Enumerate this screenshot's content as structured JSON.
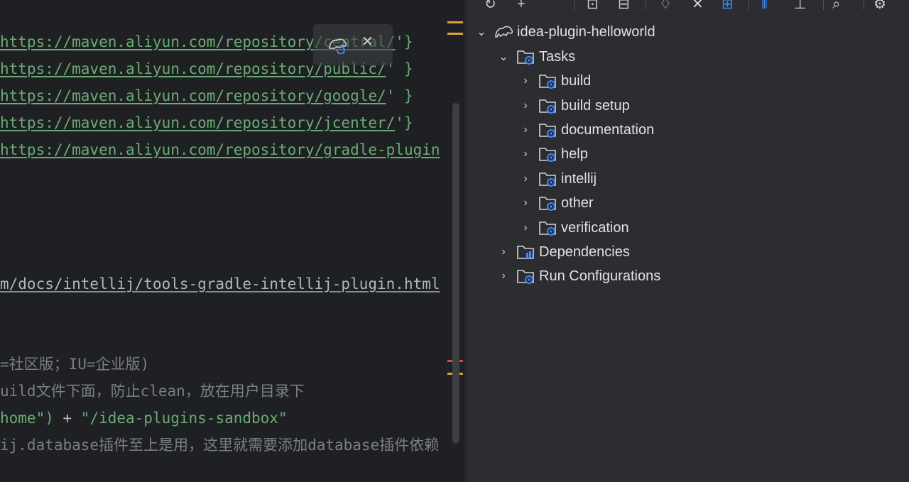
{
  "editor": {
    "lines": [
      {
        "text": "https://maven.aliyun.com/repository/central/",
        "suffix": "'}"
      },
      {
        "text": "https://maven.aliyun.com/repository/public/",
        "suffix": "' }"
      },
      {
        "text": "https://maven.aliyun.com/repository/google/",
        "suffix": "' }"
      },
      {
        "text": "https://maven.aliyun.com/repository/jcenter/",
        "suffix": "'}"
      },
      {
        "text": "https://maven.aliyun.com/repository/gradle-plugin",
        "suffix": ""
      }
    ],
    "docs_link": "m/docs/intellij/tools-gradle-intellij-plugin.html",
    "comment1": "=社区版；IU=企业版)",
    "comment2": "uild文件下面，防止clean，放在用户目录下",
    "code_home": "home\")",
    "code_plus": " + ",
    "code_sandbox": "\"/idea-plugins-sandbox\"",
    "comment3": "ij.database插件至上是用，这里就需要添加database插件依赖"
  },
  "panel": {
    "tree": {
      "root": "idea-plugin-helloworld",
      "tasks": "Tasks",
      "task_groups": [
        "build",
        "build setup",
        "documentation",
        "help",
        "intellij",
        "other",
        "verification"
      ],
      "dependencies": "Dependencies",
      "run_configurations": "Run Configurations"
    }
  },
  "colors": {
    "editor_bg": "#1f2023",
    "panel_bg": "#2b2d30",
    "string_green": "#6aab73",
    "accent_blue": "#3d8bfd",
    "marker_orange": "#d9a23c",
    "marker_red": "#c94f4f"
  }
}
